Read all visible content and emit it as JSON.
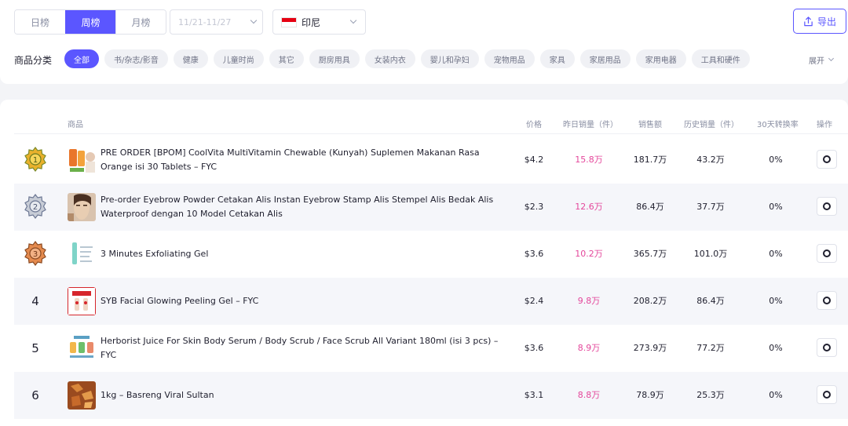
{
  "period_tabs": [
    {
      "label": "日榜",
      "active": false
    },
    {
      "label": "周榜",
      "active": true
    },
    {
      "label": "月榜",
      "active": false
    }
  ],
  "date_range": {
    "value": "11/21-11/27"
  },
  "country": {
    "label": "印尼",
    "flag_colors": [
      "#e60012",
      "#ffffff"
    ]
  },
  "export_button": {
    "label": "导出",
    "icon": "export-icon"
  },
  "category_filter": {
    "label": "商品分类",
    "items": [
      "全部",
      "书/杂志/影音",
      "健康",
      "儿童时尚",
      "其它",
      "厨房用具",
      "女装内衣",
      "婴儿和孕妇",
      "宠物用品",
      "家具",
      "家居用品",
      "家用电器",
      "工具和硬件"
    ],
    "active": "全部",
    "expand_label": "展开"
  },
  "table": {
    "headers": {
      "product": "商品",
      "price": "价格",
      "yesterday_sales": "昨日销量（件）",
      "sales_amount": "销售额",
      "history_sales": "历史销量（件）",
      "conversion_30d": "30天转换率",
      "action": "操作"
    },
    "accent_color": "#e4479b",
    "rows": [
      {
        "rank": "1",
        "rank_badge": "gold-medal-icon",
        "name": "PRE ORDER [BPOM] CoolVita MultiVitamin Chewable (Kunyah) Suplemen Makanan Rasa Orange isi 30 Tablets – FYC",
        "price": "$4.2",
        "yesterday_sales": "15.8万",
        "sales_amount": "181.7万",
        "history_sales": "43.2万",
        "conversion": "0%"
      },
      {
        "rank": "2",
        "rank_badge": "silver-medal-icon",
        "name": "Pre-order Eyebrow Powder Cetakan Alis Instan Eyebrow Stamp Alis Stempel Alis Bedak Alis Waterproof dengan 10 Model Cetakan Alis",
        "price": "$2.3",
        "yesterday_sales": "12.6万",
        "sales_amount": "86.4万",
        "history_sales": "37.7万",
        "conversion": "0%"
      },
      {
        "rank": "3",
        "rank_badge": "bronze-medal-icon",
        "name": "3 Minutes Exfoliating Gel",
        "price": "$3.6",
        "yesterday_sales": "10.2万",
        "sales_amount": "365.7万",
        "history_sales": "101.0万",
        "conversion": "0%"
      },
      {
        "rank": "4",
        "rank_badge": "",
        "name": "SYB Facial Glowing Peeling Gel – FYC",
        "price": "$2.4",
        "yesterday_sales": "9.8万",
        "sales_amount": "208.2万",
        "history_sales": "86.4万",
        "conversion": "0%"
      },
      {
        "rank": "5",
        "rank_badge": "",
        "name": "Herborist Juice For Skin Body Serum / Body Scrub / Face Scrub All Variant 180ml (isi 3 pcs) – FYC",
        "price": "$3.6",
        "yesterday_sales": "8.9万",
        "sales_amount": "273.9万",
        "history_sales": "77.2万",
        "conversion": "0%"
      },
      {
        "rank": "6",
        "rank_badge": "",
        "name": "1kg – Basreng Viral Sultan",
        "price": "$3.1",
        "yesterday_sales": "8.8万",
        "sales_amount": "78.9万",
        "history_sales": "25.3万",
        "conversion": "0%"
      }
    ]
  }
}
